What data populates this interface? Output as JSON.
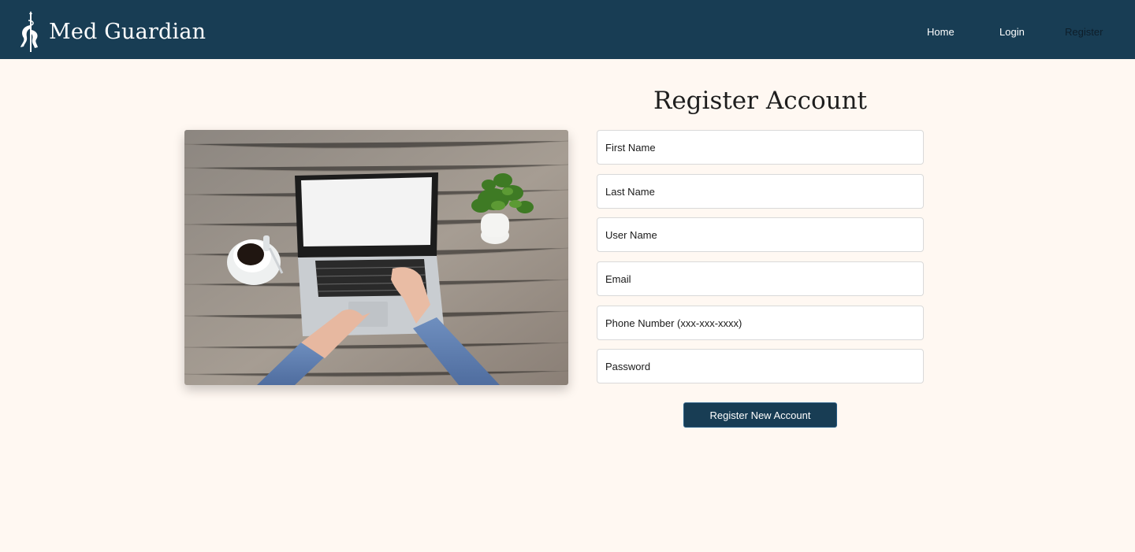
{
  "brand": {
    "name": "Med Guardian",
    "logo_icon": "caduceus-logo-icon"
  },
  "nav": {
    "home": "Home",
    "login": "Login",
    "register": "Register"
  },
  "form": {
    "title": "Register Account",
    "fields": [
      {
        "placeholder": "First Name",
        "value": ""
      },
      {
        "placeholder": "Last Name",
        "value": ""
      },
      {
        "placeholder": "User Name",
        "value": ""
      },
      {
        "placeholder": "Email",
        "value": ""
      },
      {
        "placeholder": "Phone Number (xxx-xxx-xxxx)",
        "value": ""
      },
      {
        "placeholder": "Password",
        "value": ""
      }
    ],
    "submit_label": "Register New Account"
  },
  "colors": {
    "navbar": "#183d54",
    "page_background": "#fff8f2",
    "button": "#183d54",
    "active_nav": "#0e1e2a"
  }
}
